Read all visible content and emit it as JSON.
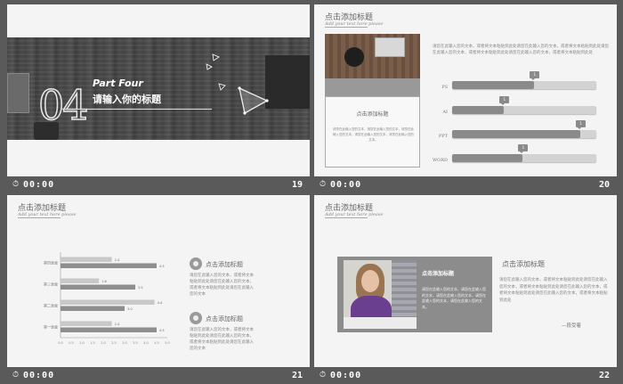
{
  "slides": [
    {
      "part_label": "Part Four",
      "number": "04",
      "title": "请输入你的标题",
      "footer": {
        "time": "00:00",
        "page": "19"
      }
    },
    {
      "title": "点击添加标题",
      "subtitle": "Add your text here please",
      "card_title": "点击添加标题",
      "card_text": "请您在此输入您的文本，请您在此输入您的文本，请您在此输入您的文本，请您在此输入您的文本，请您在此输入您的文本。",
      "paragraph": "请您在此输入您的文本，或者将文本粘贴到此处请您在此输入您的文本，或者将文本粘贴到此处请您在此输入您的文本，或者将文本粘贴到此处请您在此输入您的文本，或者将文本粘贴到此处",
      "bars": [
        {
          "label": "PS",
          "value": 0.57,
          "badge": "1"
        },
        {
          "label": "AI",
          "value": 0.36,
          "badge": "1"
        },
        {
          "label": "PPT",
          "value": 0.89,
          "badge": "1"
        },
        {
          "label": "WORD",
          "value": 0.49,
          "badge": "1"
        }
      ],
      "footer": {
        "time": "00:00",
        "page": "20"
      }
    },
    {
      "title": "点击添加标题",
      "subtitle": "Add your text here please",
      "item1_title": "点击添加标题",
      "item1_text": "请您在此输入您的文本，或者将文本粘贴到此处请您在此输入您的文本，或者将文本粘贴到此处请您在此输入您的文本",
      "item2_title": "点击添加标题",
      "item2_text": "请您在此输入您的文本，或者将文本粘贴到此处请您在此输入您的文本，或者将文本粘贴到此处请您在此输入您的文本",
      "footer": {
        "time": "00:00",
        "page": "21"
      }
    },
    {
      "title": "点击添加标题",
      "subtitle": "Add your text here please",
      "box_title": "点击添加标题",
      "box_text": "请您在此输入您的文本，请您在此输入您的文本，请您在此输入您的文本，请您在此输入您的文本，请您在此输入您的文本。",
      "side_title": "点击添加标题",
      "side_text": "请您在此输入您的文本，或者将文本粘贴到此处请您在此输入您的文本，或者将文本粘贴到此处请您在此输入您的文本，或者将文本粘贴到此处请您在此输入您的文本，或者将文本粘贴到此处",
      "signature": "—段受着",
      "footer": {
        "time": "00:00",
        "page": "22"
      }
    }
  ],
  "chart_data": {
    "type": "bar",
    "orientation": "horizontal",
    "categories": [
      "第四季度",
      "第三季度",
      "第二季度",
      "第一季度"
    ],
    "series": [
      {
        "color": "#c8c8c8",
        "values": [
          2.4,
          1.8,
          4.4,
          2.4
        ]
      },
      {
        "color": "#8e8e8e",
        "values": [
          4.5,
          3.5,
          3.0,
          4.5
        ]
      }
    ],
    "xlim": [
      0,
      5
    ],
    "xticks": [
      "0.0",
      "0.5",
      "1.0",
      "1.5",
      "2.0",
      "2.5",
      "3.0",
      "3.5",
      "4.0",
      "4.5",
      "5.0"
    ]
  }
}
